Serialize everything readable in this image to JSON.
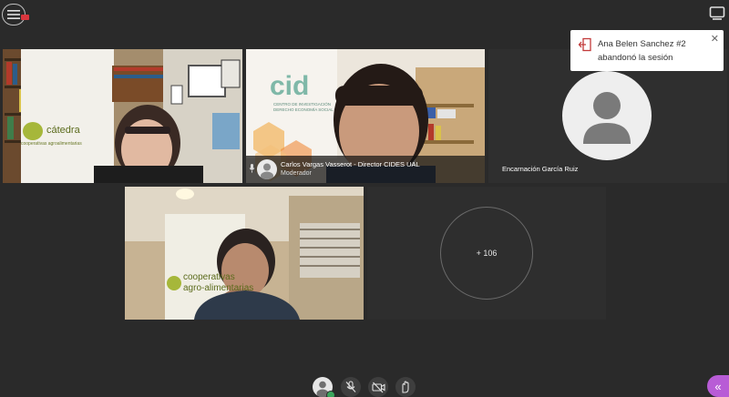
{
  "toolbar": {
    "menu_icon": "hamburger-menu-icon",
    "recording_icon": "recording-badge-icon",
    "screen_icon": "screen-layout-icon"
  },
  "notification": {
    "icon": "leave-session-icon",
    "text": "Ana Belen Sanchez #2 abandonó la sesión",
    "close_label": "✕"
  },
  "participants": [
    {
      "name": "",
      "role": "",
      "tile": "catedra-speaker"
    },
    {
      "name": "Carlos Vargas Vasserot - Director CIDES UAL",
      "role": "Moderador",
      "tile": "moderator"
    },
    {
      "name": "Encarnación García Ruiz",
      "role": "",
      "tile": "avatar-placeholder"
    },
    {
      "name": "",
      "role": "",
      "tile": "cooperativas-speaker"
    }
  ],
  "overflow": {
    "label": "+ 106"
  },
  "backdrop_text": {
    "catedra_banner": "cátedra",
    "catedra_sub": "cooperativas agroalimentarias",
    "cides_logo": "cid",
    "cides_line1": "CENTRO DE INVESTIGACIÓN",
    "cides_line2": "DERECHO ECONOMÍA SOCIAL",
    "coop_line1": "cooperativas",
    "coop_line2": "agro-alimentarias"
  },
  "controls": {
    "avatar": "self-avatar-icon",
    "mic": "microphone-muted-icon",
    "camera": "camera-off-icon",
    "hand": "raise-hand-icon",
    "panel": "collapse-panel-icon",
    "panel_glyph": "«"
  },
  "colors": {
    "background": "#2a2a2a",
    "tile_bg": "#1f1f1f",
    "accent_purple": "#b85cd6",
    "recording_red": "#d9363e",
    "status_green": "#3ba55c"
  }
}
